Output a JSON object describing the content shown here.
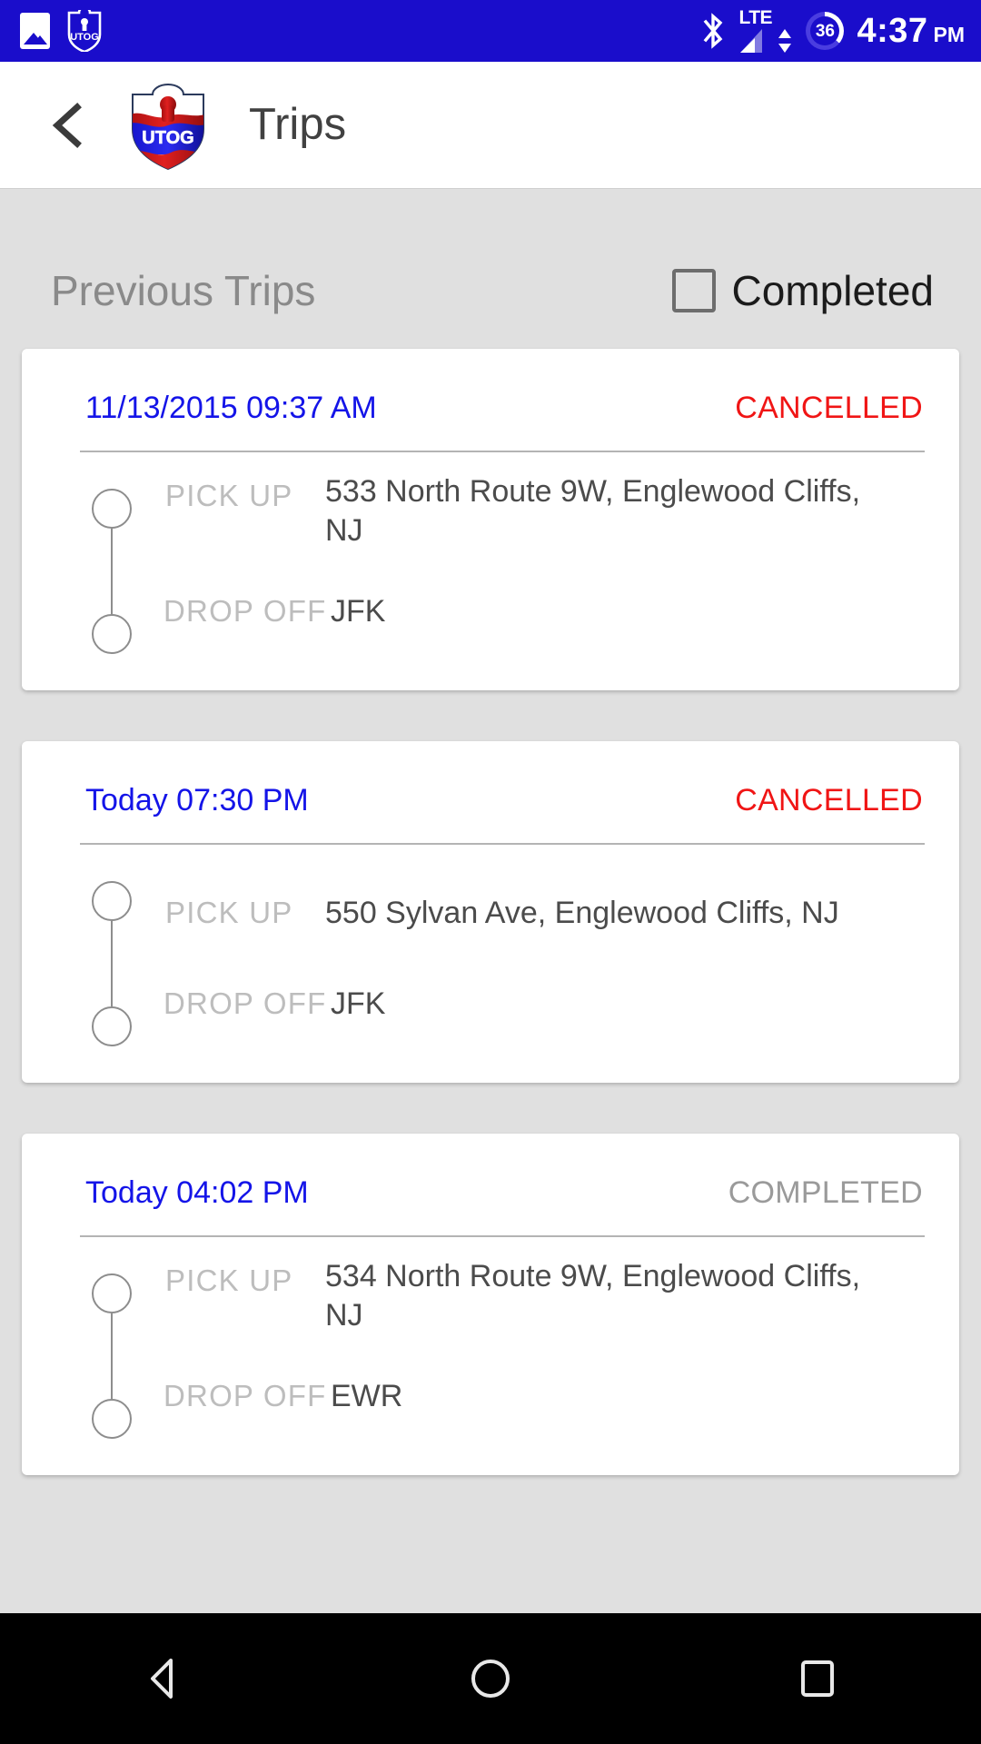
{
  "status_bar": {
    "icons": [
      "photo-icon",
      "utog-app-icon",
      "bluetooth-icon",
      "signal-icon"
    ],
    "network_label": "LTE",
    "battery_level": "36",
    "time": "4:37",
    "meridiem": "PM",
    "background_color": "#1a0dcb"
  },
  "app_bar": {
    "back_label": "back",
    "logo_label": "UTOG",
    "title": "Trips"
  },
  "section": {
    "title": "Previous Trips",
    "filter_label": "Completed",
    "filter_checked": false
  },
  "labels": {
    "pickup": "PICK UP",
    "dropoff": "DROP OFF"
  },
  "trips": [
    {
      "date": "11/13/2015 09:37 AM",
      "status": "CANCELLED",
      "status_kind": "cancelled",
      "pickup": "533 North Route 9W, Englewood Cliffs, NJ",
      "dropoff": "JFK"
    },
    {
      "date": "Today 07:30 PM",
      "status": "CANCELLED",
      "status_kind": "cancelled",
      "pickup": "550 Sylvan Ave, Englewood Cliffs, NJ",
      "dropoff": "JFK"
    },
    {
      "date": "Today 04:02 PM",
      "status": "COMPLETED",
      "status_kind": "completed",
      "pickup": "534 North Route 9W, Englewood Cliffs, NJ",
      "dropoff": "EWR"
    }
  ],
  "nav_bar": {
    "back": "back-triangle-icon",
    "home": "home-circle-icon",
    "recents": "recents-square-icon"
  },
  "colors": {
    "status_bar": "#1a0dcb",
    "date_blue": "#1414e8",
    "cancelled_red": "#f01515",
    "completed_gray": "#9a9a9a",
    "page_bg": "#e0e0e0"
  }
}
